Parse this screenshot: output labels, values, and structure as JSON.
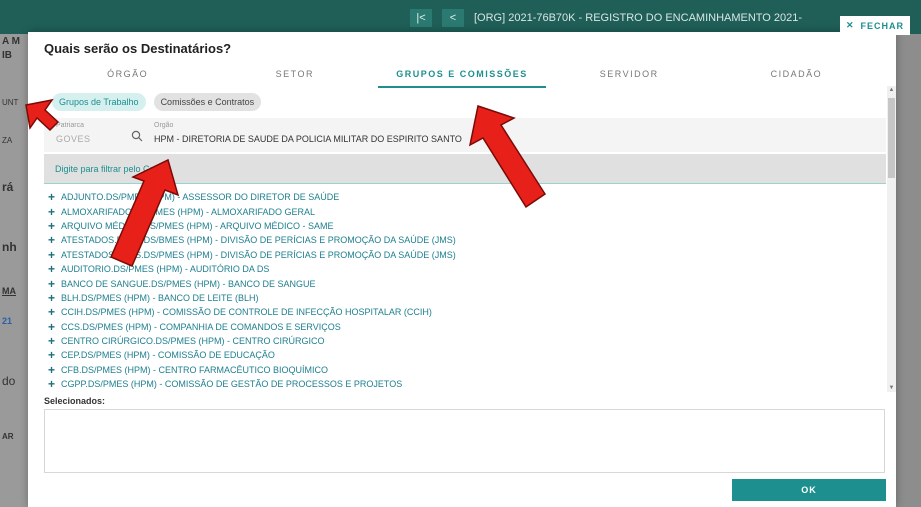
{
  "background": {
    "record_title": "[ORG] 2021-76B70K - REGISTRO DO ENCAMINHAMENTO 2021-",
    "left_fragments": [
      "A M",
      "IB",
      "UNT",
      "ZA",
      "rá",
      "nh",
      "MA",
      "21",
      "do",
      "AR"
    ]
  },
  "close_button": {
    "label": "FECHAR"
  },
  "modal": {
    "title": "Quais serão os Destinatários?",
    "tabs": [
      {
        "label": "ÓRGÃO",
        "active": false
      },
      {
        "label": "SETOR",
        "active": false
      },
      {
        "label": "GRUPOS E COMISSÕES",
        "active": true
      },
      {
        "label": "SERVIDOR",
        "active": false
      },
      {
        "label": "CIDADÃO",
        "active": false
      }
    ],
    "chips": [
      {
        "label": "Grupos de Trabalho",
        "active": true
      },
      {
        "label": "Comissões e Contratos",
        "active": false
      }
    ],
    "patriarca": {
      "label": "Patriarca",
      "value": "GOVES"
    },
    "orgao": {
      "label": "Orgão",
      "value": "HPM - DIRETORIA DE SAUDE DA POLICIA MILITAR DO ESPIRITO SANTO"
    },
    "group_filter_placeholder": "Digite para filtrar pelo Grupo",
    "groups": [
      "ADJUNTO.DS/PMES (HPM) - ASSESSOR DO DIRETOR DE SAÚDE",
      "ALMOXARIFADO.DS/PMES (HPM) - ALMOXARIFADO GERAL",
      "ARQUIVO MÉDICO.DS/PMES (HPM) - ARQUIVO MÉDICO - SAME",
      "ATESTADOS.DPPS.DS/BMES (HPM) - DIVISÃO DE PERÍCIAS E PROMOÇÃO DA SAÚDE (JMS)",
      "ATESTADOS.DPPS.DS/PMES (HPM) - DIVISÃO DE PERÍCIAS E PROMOÇÃO DA SAÚDE (JMS)",
      "AUDITORIO.DS/PMES (HPM) - AUDITÓRIO DA DS",
      "BANCO DE SANGUE.DS/PMES (HPM) - BANCO DE SANGUE",
      "BLH.DS/PMES (HPM) - BANCO DE LEITE (BLH)",
      "CCIH.DS/PMES (HPM) - COMISSÃO DE CONTROLE DE INFECÇÃO HOSPITALAR (CCIH)",
      "CCS.DS/PMES (HPM) - COMPANHIA DE COMANDOS E SERVIÇOS",
      "CENTRO CIRÚRGICO.DS/PMES (HPM) - CENTRO CIRÚRGICO",
      "CEP.DS/PMES (HPM) - COMISSÃO DE EDUCAÇÃO",
      "CFB.DS/PMES (HPM) - CENTRO FARMACÊUTICO BIOQUÍMICO",
      "CGPP.DS/PMES (HPM) - COMISSÃO DE GESTÃO DE PROCESSOS E PROJETOS"
    ],
    "selected_label": "Selecionados:",
    "ok_label": "OK"
  },
  "colors": {
    "accent": "#1d8f8f",
    "arrow": "#e8201a"
  }
}
